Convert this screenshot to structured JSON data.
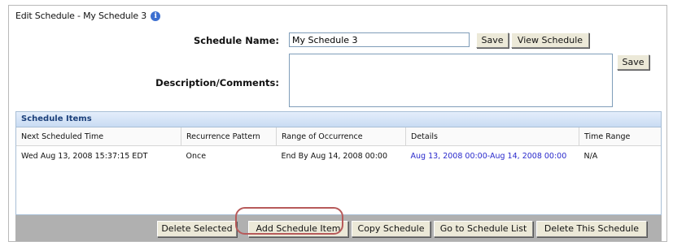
{
  "header": {
    "title": "Edit Schedule - My Schedule 3",
    "info_icon": "info-icon"
  },
  "form": {
    "name_label": "Schedule Name:",
    "name_value": "My Schedule 3",
    "save_label": "Save",
    "view_label": "View Schedule",
    "desc_label": "Description/Comments:",
    "desc_value": "",
    "desc_save_label": "Save"
  },
  "grid": {
    "title": "Schedule Items",
    "columns": [
      "Next Scheduled Time",
      "Recurrence Pattern",
      "Range of Occurrence",
      "Details",
      "Time Range"
    ],
    "rows": [
      [
        "Wed Aug 13, 2008 15:37:15 EDT",
        "Once",
        "End By Aug 14, 2008 00:00",
        "Aug 13, 2008 00:00-Aug 14, 2008 00:00",
        "N/A"
      ]
    ]
  },
  "footer": {
    "buttons": [
      "Delete Selected",
      "Add Schedule Item",
      "Copy Schedule",
      "Go to Schedule List",
      "Delete This Schedule"
    ]
  },
  "colors": {
    "highlight": "#b75a5a",
    "link": "#2a2acc",
    "grid_header": "#c9dcf3"
  }
}
